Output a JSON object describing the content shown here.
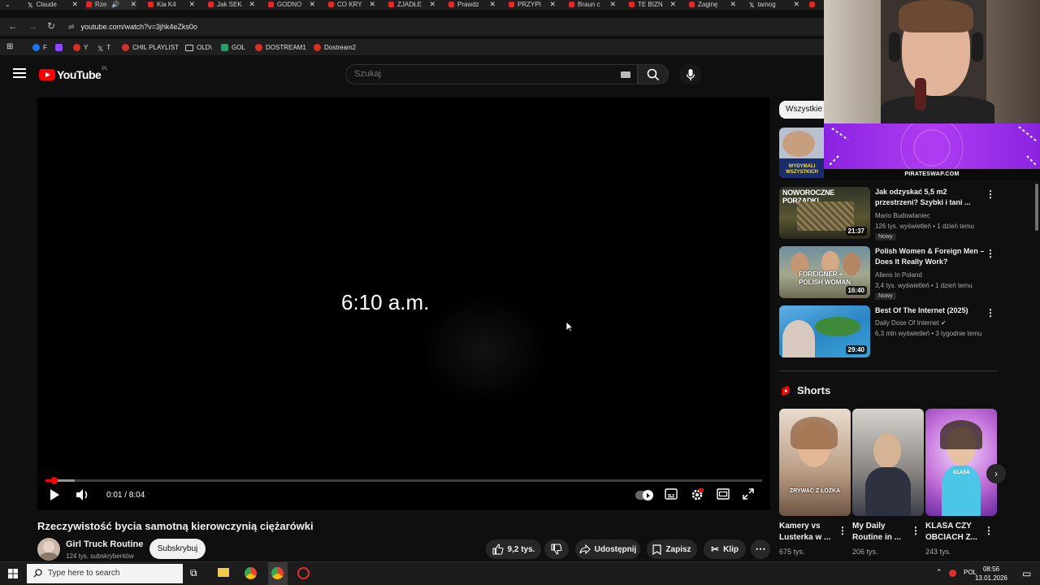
{
  "browser": {
    "tabs": [
      {
        "label": "Claude",
        "active": false,
        "icon": "x-icon"
      },
      {
        "label": "Rze",
        "active": true,
        "icon": "youtube-icon"
      },
      {
        "label": "Kia K4",
        "active": false,
        "icon": "youtube-icon"
      },
      {
        "label": "Jak SEK",
        "active": false,
        "icon": "youtube-icon"
      },
      {
        "label": "GODNO",
        "active": false,
        "icon": "youtube-icon"
      },
      {
        "label": "CO KRY",
        "active": false,
        "icon": "youtube-icon"
      },
      {
        "label": "ZJADŁE",
        "active": false,
        "icon": "youtube-icon"
      },
      {
        "label": "Prawdz",
        "active": false,
        "icon": "youtube-icon"
      },
      {
        "label": "PRZYPI",
        "active": false,
        "icon": "youtube-icon"
      },
      {
        "label": "Braun c",
        "active": false,
        "icon": "youtube-icon"
      },
      {
        "label": "TE BIZN",
        "active": false,
        "icon": "youtube-icon"
      },
      {
        "label": "Zaginę",
        "active": false,
        "icon": "youtube-icon"
      },
      {
        "label": "tamog",
        "active": false,
        "icon": "x-icon"
      }
    ],
    "url": "youtube.com/watch?v=3jhk4eZks0o",
    "bookmarks": [
      {
        "label": "F",
        "icon": "facebook-icon"
      },
      {
        "label": "",
        "icon": "twitch-icon"
      },
      {
        "label": "Y",
        "icon": "youtube-icon"
      },
      {
        "label": "T",
        "icon": "x-icon"
      },
      {
        "label": "CHIL PLAYLIST",
        "icon": "youtube-icon"
      },
      {
        "label": "OLD\\",
        "icon": "folder-icon"
      },
      {
        "label": "GOL",
        "icon": "gol-icon"
      },
      {
        "label": "DOSTREAM1",
        "icon": "youtube-icon"
      },
      {
        "label": "Dostream2",
        "icon": "youtube-icon"
      }
    ]
  },
  "header": {
    "logo_text": "YouTube",
    "logo_country": "PL",
    "search_placeholder": "Szukaj"
  },
  "player": {
    "overlay_text": "6:10 a.m.",
    "time_display": "0:01 / 8:04",
    "progress_fraction": 0.002,
    "autoplay_on": true
  },
  "video": {
    "title": "Rzeczywistość bycia samotną kierowczynią ciężarówki",
    "channel_name": "Girl Truck Routine",
    "channel_subs": "124 tys. subskrybentów",
    "subscribe_label": "Subskrybuj",
    "likes": "9,2 tys.",
    "share_label": "Udostępnij",
    "save_label": "Zapisz",
    "clip_label": "Klip"
  },
  "sidebar": {
    "chip_all": "Wszystkie",
    "first_thumb_text": "WYDYMALI WSZYSTKICH",
    "recommendations": [
      {
        "title": "Jak odzyskać 5,5 m2 przestrzeni? Szybki i tani ...",
        "channel": "Mario Budowlaniec",
        "meta": "126 tys. wyświetleń • 1 dzień temu",
        "badge": "Nowy",
        "duration": "21:37",
        "thumb_text": "NOWOROCZNE PORZĄDKI"
      },
      {
        "title": "Polish Women & Foreign Men – Does It Really Work?",
        "channel": "Aliens In Poland",
        "meta": "3,4 tys. wyświetleń • 1 dzień temu",
        "badge": "Nowy",
        "duration": "16:40",
        "thumb_text": "FOREIGNER + POLISH WOMAN"
      },
      {
        "title": "Best Of The Internet (2025)",
        "channel": "Daily Dose Of Internet",
        "meta": "6,3 mln wyświetleń • 3 tygodnie temu",
        "badge": "",
        "duration": "29:40",
        "thumb_text": ""
      }
    ],
    "shorts_heading": "Shorts",
    "shorts": [
      {
        "title": "Kamery vs Lusterka w ...",
        "views": "675 tys.",
        "overlay": "ZRYWAĆ Z ŁÓŻKA"
      },
      {
        "title": "My Daily Routine in ...",
        "views": "206 tys.",
        "overlay": ""
      },
      {
        "title": "KLASA CZY OBCIACH Z...",
        "views": "243 tys.",
        "overlay": "KLASA"
      }
    ]
  },
  "stream_overlay": {
    "banner_url": "PIRATESWAP.COM"
  },
  "taskbar": {
    "search_placeholder": "Type here to search",
    "language": "POL",
    "time": "08:56",
    "date": "13.01.2026"
  },
  "colors": {
    "youtube_red": "#ff0000",
    "background": "#0f0f0f",
    "banner_purple": "#a22ff0"
  }
}
